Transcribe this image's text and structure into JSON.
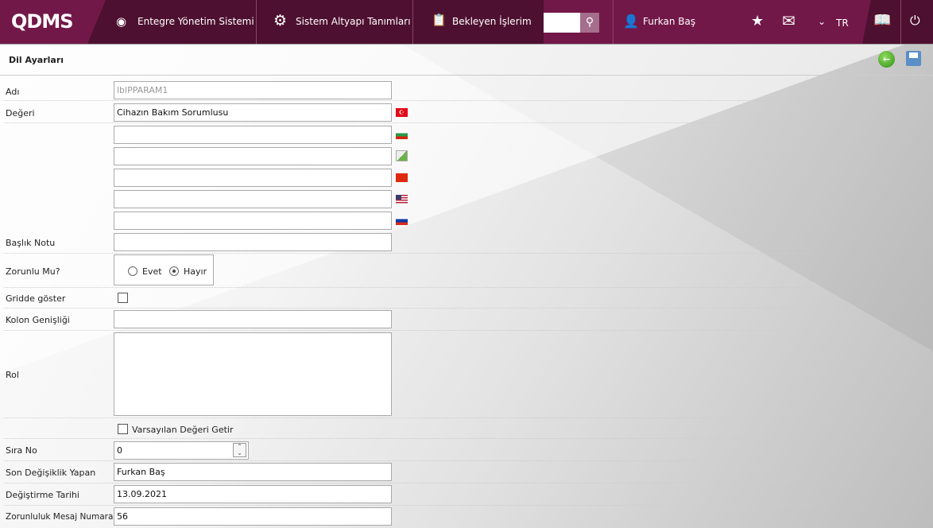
{
  "header": {
    "logo": "QDMS",
    "nav": [
      "Entegre Yönetim Sistemi",
      "Sistem Altyapı Tanımları",
      "Bekleyen İşlerim"
    ],
    "search_value": "",
    "user": "Furkan Baş",
    "language": "TR"
  },
  "page": {
    "title": "Dil Ayarları"
  },
  "form": {
    "adi_label": "Adı",
    "adi_value": "lblPPARAM1",
    "degeri_label": "Değeri",
    "degeri_tr": "Cihazın Bakım Sorumlusu",
    "baslik_label": "Başlık Notu",
    "zorunlu_label": "Zorunlu Mu?",
    "evet": "Evet",
    "hayir": "Hayır",
    "zorunlu_selected": "Hayır",
    "gridde_label": "Gridde göster",
    "kolon_label": "Kolon Genişliği",
    "rol_label": "Rol",
    "varsayilan_label": "Varsayılan Değeri Getir",
    "sira_label": "Sıra No",
    "sira_value": "0",
    "son_label": "Son Değişiklik Yapan",
    "son_value": "Furkan Baş",
    "tarih_label": "Değiştirme Tarihi",
    "tarih_value": "13.09.2021",
    "mesaj_label": "Zorunluluk Mesaj Numarası",
    "mesaj_value": "56"
  },
  "colors": {
    "brand": "#721848",
    "brand_dark": "#4e1030"
  }
}
